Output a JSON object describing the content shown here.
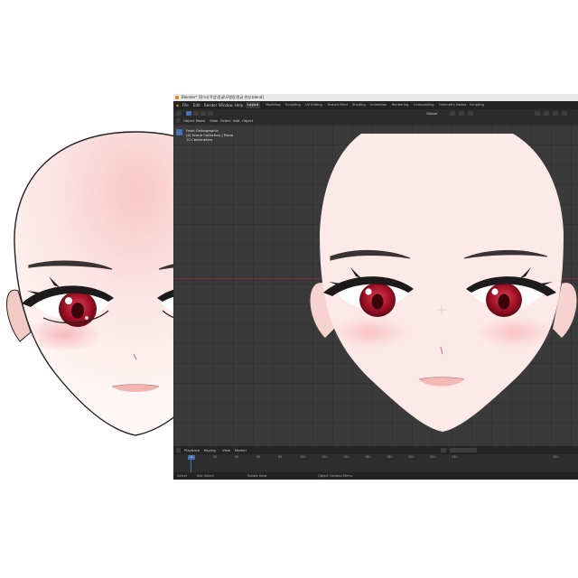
{
  "window": {
    "title": "Blender* [D:\\내 작업\\얼굴\\모델링\\얼굴 완성.blend]",
    "menu": [
      "File",
      "Edit",
      "Render",
      "Window",
      "Help"
    ],
    "workspaces": [
      "Layout",
      "Modeling",
      "Sculpting",
      "UV Editing",
      "Texture Paint",
      "Shading",
      "Animation",
      "Rendering",
      "Compositing",
      "Geometry Nodes",
      "Scripting"
    ],
    "active_workspace": "Layout"
  },
  "toolbar": {
    "mode": "Object Mode",
    "menus": [
      "View",
      "Select",
      "Add",
      "Object"
    ],
    "orientation": "Global"
  },
  "viewport": {
    "overlay_lines": [
      "Front Orthographic",
      "(0) Scene Collection | Plane",
      "10 Centimeters"
    ]
  },
  "timeline": {
    "menus": [
      "Playback",
      "Keying",
      "View",
      "Marker"
    ],
    "current_frame": "1",
    "ticks": [
      "1",
      "20",
      "40",
      "60",
      "80",
      "100",
      "120",
      "140",
      "160",
      "180",
      "200",
      "220",
      "240",
      "250"
    ]
  },
  "statusbar": {
    "items": [
      "Select",
      "Box Select",
      "Rotate View",
      "Object Context Menu"
    ]
  },
  "colors": {
    "accent": "#4772b3",
    "skin": "#fbe8e6",
    "eye": "#b0142a"
  }
}
